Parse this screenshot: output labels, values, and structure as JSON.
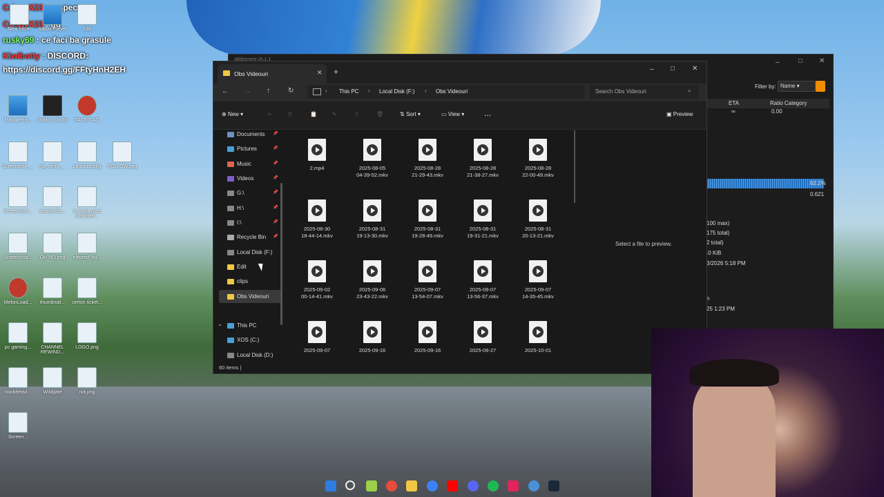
{
  "chat": [
    {
      "user": "CrispyX23",
      "sep": " : ",
      "msg": "respect"
    },
    {
      "user": "CrispyX23",
      "sep": " : ",
      "msg": "gg"
    },
    {
      "user": "rusky69",
      "sep": " : ",
      "msg": "ce faci ba grasule"
    },
    {
      "user": "Kiwibotty",
      "sep": " : ",
      "msg": "DISCORD:"
    },
    {
      "user": "",
      "sep": "",
      "msg": "https://discord.gg/FFtyHnH2EH"
    }
  ],
  "desktop_icons": [
    {
      "label": "New folder"
    },
    {
      "label": "roblox Player"
    },
    {
      "label": "Edit"
    },
    {
      "label": "Malwareby..."
    },
    {
      "label": "Roblox Studio"
    },
    {
      "label": "FACEIT AC"
    },
    {
      "label": "Screenshot_..."
    },
    {
      "label": "ma_omor_..."
    },
    {
      "label": "parasuta.png"
    },
    {
      "label": "FOLLOW.png"
    },
    {
      "label": "Screenshot..."
    },
    {
      "label": "deathnote..."
    },
    {
      "label": "nevasta mea cumintefi..."
    },
    {
      "label": "Screenshot..."
    },
    {
      "label": "OH NO.png"
    },
    {
      "label": "eiepred_su..."
    },
    {
      "label": "MelonLoad..."
    },
    {
      "label": "thumbnail..."
    },
    {
      "label": "certon ticket..."
    },
    {
      "label": "pc gaming..."
    },
    {
      "label": "CHANNEL REWIND..."
    },
    {
      "label": "LOGO.png"
    },
    {
      "label": "noobheavi..."
    },
    {
      "label": "Wildgate"
    },
    {
      "label": "not.png"
    },
    {
      "label": "Screen..."
    }
  ],
  "bgwin": {
    "title": "qBittorrent v5.1.1",
    "filter_label": "Filter by:",
    "filter_value": "Name",
    "col_eta": "ETA",
    "col_ratio_category": "Ratio Category",
    "eta_val": "∞",
    "ratio_val": "0.00",
    "pct": "62.2%",
    "ratio2": "0.621",
    "lines": [
      "100 max)",
      "175 total)",
      "2 total)",
      ".0 KiB",
      "3/2026 5:18 PM",
      "n",
      "25 1:23 PM"
    ]
  },
  "explorer": {
    "tab_title": "Obs Videouri",
    "breadcrumb": [
      "This PC",
      "Local Disk (F:)",
      "Obs Videouri"
    ],
    "search_placeholder": "Search Obs Videouri",
    "cmd": {
      "new": "New",
      "sort": "Sort",
      "view": "View",
      "more": "...",
      "preview": "Preview"
    },
    "nav": [
      {
        "label": "Documents",
        "pin": true,
        "color": "#6e8ec4"
      },
      {
        "label": "Pictures",
        "pin": true,
        "color": "#4a9fd8"
      },
      {
        "label": "Music",
        "pin": true,
        "color": "#e0654f"
      },
      {
        "label": "Videos",
        "pin": true,
        "color": "#7b5fc7"
      },
      {
        "label": "G:\\",
        "pin": true,
        "color": "#888"
      },
      {
        "label": "H:\\",
        "pin": true,
        "color": "#888"
      },
      {
        "label": "I:\\",
        "pin": true,
        "color": "#888"
      },
      {
        "label": "Recycle Bin",
        "pin": true,
        "color": "#aaa"
      },
      {
        "label": "Local Disk (F:)",
        "pin": false,
        "color": "#888"
      },
      {
        "label": "Edit",
        "pin": false,
        "color": "#f2c744"
      },
      {
        "label": "clips",
        "pin": false,
        "color": "#f2c744"
      },
      {
        "label": "Obs Videouri",
        "pin": false,
        "color": "#f2c744"
      },
      {
        "label": "This PC",
        "pin": false,
        "color": "#4a9fd8"
      },
      {
        "label": "XOS (C:)",
        "pin": false,
        "color": "#4a9fd8"
      },
      {
        "label": "Local Disk (D:)",
        "pin": false,
        "color": "#888"
      }
    ],
    "files": [
      "2.mp4",
      "2025-08-05\n04-39-52.mkv",
      "2025-08-28\n21-29-43.mkv",
      "2025-08-28\n21-38-27.mkv",
      "2025-08-28\n22-00-49.mkv",
      "2025-08-30\n18-44-14.mkv",
      "2025-08-31\n19-13-30.mkv",
      "2025-08-31\n19-28-49.mkv",
      "2025-08-31\n19-31-21.mkv",
      "2025-08-31\n20-13-21.mkv",
      "2025-09-02\n00-14-41.mkv",
      "2025-09-06\n23-43-22.mkv",
      "2025-09-07\n13-54-07.mkv",
      "2025-09-07\n13-56-37.mkv",
      "2025-09-07\n14-35-45.mkv",
      "2025-09-07",
      "2025-09-16",
      "2025-09-16",
      "2025-09-27",
      "2025-10-01"
    ],
    "preview_text": "Select a file to preview.",
    "status": "60 items"
  }
}
